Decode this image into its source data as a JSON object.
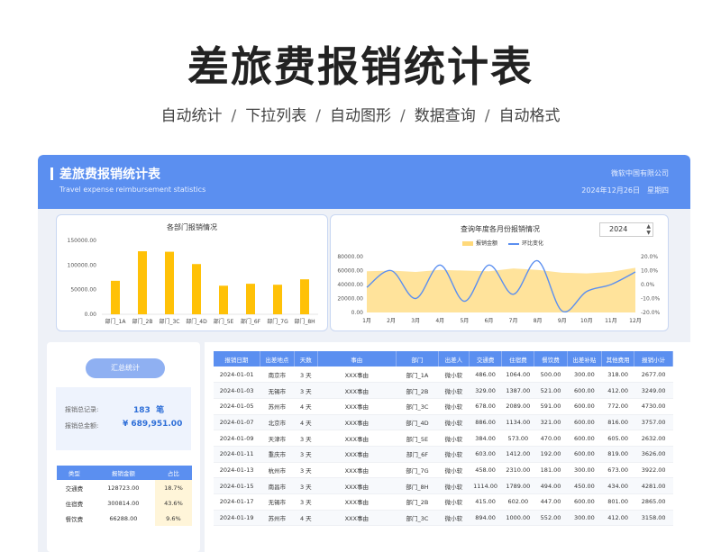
{
  "hero": {
    "title": "差旅费报销统计表",
    "features": [
      "自动统计",
      "下拉列表",
      "自动图形",
      "数据查询",
      "自动格式"
    ],
    "separator": "/"
  },
  "banner": {
    "title": "差旅费报销统计表",
    "subtitle": "Travel expense reimbursement statistics",
    "company": "微软中国有限公司",
    "date": "2024年12月26日",
    "weekday": "星期四"
  },
  "colors": {
    "accent": "#5b8ff0",
    "bar": "#ffc107",
    "area": "#ffd97a",
    "line": "#5b8ff0"
  },
  "chart_data": [
    {
      "type": "bar",
      "title": "各部门报销情况",
      "categories": [
        "部门_1A",
        "部门_2B",
        "部门_3C",
        "部门_4D",
        "部门_5E",
        "部门_6F",
        "部门_7G",
        "部门_8H"
      ],
      "values": [
        68000,
        128000,
        127000,
        102000,
        58000,
        62000,
        60000,
        71000
      ],
      "ylim": [
        0,
        150000
      ],
      "yticks": [
        "0.00",
        "50000.00",
        "100000.00",
        "150000.00"
      ]
    },
    {
      "type": "line",
      "title": "查询年度各月份报销情况",
      "year": "2024",
      "categories": [
        "1月",
        "2月",
        "3月",
        "4月",
        "5月",
        "6月",
        "7月",
        "8月",
        "9月",
        "10月",
        "11月",
        "12月"
      ],
      "series": [
        {
          "name": "报销金额",
          "type": "area",
          "values": [
            59000,
            60000,
            58000,
            61000,
            60000,
            59000,
            63000,
            61000,
            57000,
            56000,
            58000,
            64000
          ]
        },
        {
          "name": "环比变化",
          "type": "line",
          "values": [
            -0.02,
            0.1,
            -0.1,
            0.14,
            -0.12,
            0.14,
            -0.07,
            0.17,
            -0.19,
            -0.05,
            0.0,
            0.09
          ]
        }
      ],
      "ylim": [
        0,
        80000
      ],
      "yticks": [
        "0.00",
        "20000.00",
        "40000.00",
        "60000.00",
        "80000.00"
      ],
      "y2lim": [
        -0.2,
        0.2
      ],
      "y2ticks": [
        "-20.0%",
        "-10.0%",
        "0.0%",
        "10.0%",
        "20.0%"
      ]
    }
  ],
  "summary": {
    "button": "汇总统计",
    "count_label": "报销总记录:",
    "count_value": "183",
    "count_unit": "笔",
    "amount_label": "报销总金额:",
    "amount_value": "¥ 689,951.00"
  },
  "category_table": {
    "headers": [
      "类型",
      "报销金额",
      "占比"
    ],
    "rows": [
      [
        "交通费",
        "128723.00",
        "18.7%"
      ],
      [
        "住宿费",
        "300814.00",
        "43.6%"
      ],
      [
        "餐饮费",
        "66288.00",
        "9.6%"
      ]
    ]
  },
  "main_table": {
    "headers": [
      "报销日期",
      "出差地点",
      "天数",
      "事由",
      "部门",
      "出差人",
      "交通费",
      "住宿费",
      "餐饮费",
      "出差补贴",
      "其他费用",
      "报销小计"
    ],
    "rows": [
      [
        "2024-01-01",
        "南京市",
        "3 天",
        "XXX事由",
        "部门_1A",
        "微小软",
        "486.00",
        "1064.00",
        "500.00",
        "300.00",
        "318.00",
        "2677.00"
      ],
      [
        "2024-01-03",
        "无锡市",
        "3 天",
        "XXX事由",
        "部门_2B",
        "微小软",
        "329.00",
        "1387.00",
        "521.00",
        "600.00",
        "412.00",
        "3249.00"
      ],
      [
        "2024-01-05",
        "苏州市",
        "4 天",
        "XXX事由",
        "部门_3C",
        "微小软",
        "678.00",
        "2089.00",
        "591.00",
        "600.00",
        "772.00",
        "4730.00"
      ],
      [
        "2024-01-07",
        "北京市",
        "4 天",
        "XXX事由",
        "部门_4D",
        "微小软",
        "886.00",
        "1134.00",
        "321.00",
        "600.00",
        "816.00",
        "3757.00"
      ],
      [
        "2024-01-09",
        "天津市",
        "3 天",
        "XXX事由",
        "部门_5E",
        "微小软",
        "384.00",
        "573.00",
        "470.00",
        "600.00",
        "605.00",
        "2632.00"
      ],
      [
        "2024-01-11",
        "重庆市",
        "3 天",
        "XXX事由",
        "部门_6F",
        "微小软",
        "603.00",
        "1412.00",
        "192.00",
        "600.00",
        "819.00",
        "3626.00"
      ],
      [
        "2024-01-13",
        "杭州市",
        "3 天",
        "XXX事由",
        "部门_7G",
        "微小软",
        "458.00",
        "2310.00",
        "181.00",
        "300.00",
        "673.00",
        "3922.00"
      ],
      [
        "2024-01-15",
        "南昌市",
        "3 天",
        "XXX事由",
        "部门_8H",
        "微小软",
        "1114.00",
        "1789.00",
        "494.00",
        "450.00",
        "434.00",
        "4281.00"
      ],
      [
        "2024-01-17",
        "无锡市",
        "3 天",
        "XXX事由",
        "部门_2B",
        "微小软",
        "415.00",
        "602.00",
        "447.00",
        "600.00",
        "801.00",
        "2865.00"
      ],
      [
        "2024-01-19",
        "苏州市",
        "4 天",
        "XXX事由",
        "部门_3C",
        "微小软",
        "894.00",
        "1000.00",
        "552.00",
        "300.00",
        "412.00",
        "3158.00"
      ]
    ]
  }
}
